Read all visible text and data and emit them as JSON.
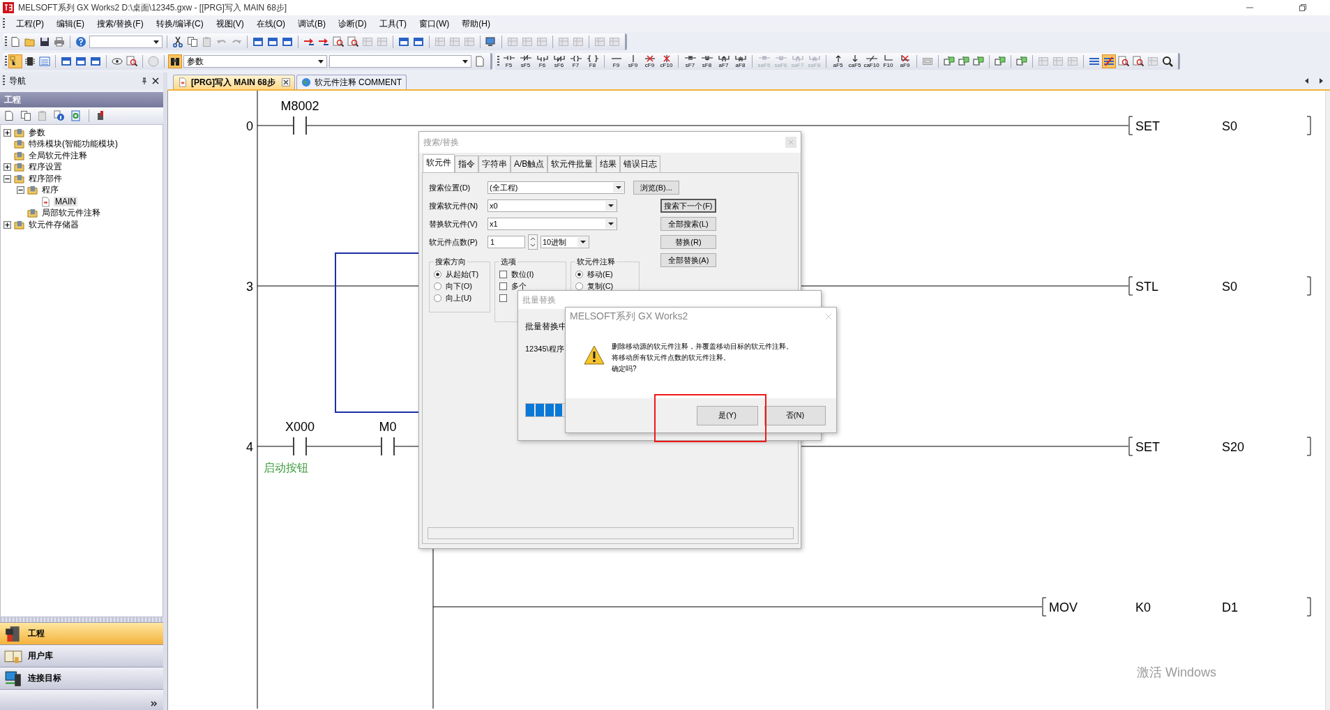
{
  "window": {
    "title": "MELSOFT系列 GX Works2 D:\\桌面\\12345.gxw - [[PRG]写入 MAIN 68步]"
  },
  "menu": [
    "工程(P)",
    "编辑(E)",
    "搜索/替换(F)",
    "转换/编译(C)",
    "视图(V)",
    "在线(O)",
    "调试(B)",
    "诊断(D)",
    "工具(T)",
    "窗口(W)",
    "帮助(H)"
  ],
  "toolbar": {
    "element_combo": "参数"
  },
  "toggle_buttons": [
    {
      "selected": true
    },
    {
      "selected": true
    },
    {
      "selected": true
    }
  ],
  "function_key_groups": [
    [
      {
        "label": "F5",
        "kind": "contact",
        "disabled": false
      },
      {
        "label": "sF5",
        "kind": "nc",
        "disabled": false
      },
      {
        "label": "F6",
        "kind": "par",
        "disabled": false
      },
      {
        "label": "sF6",
        "kind": "par_nc",
        "disabled": false
      },
      {
        "label": "F7",
        "kind": "coil",
        "disabled": false
      },
      {
        "label": "F8",
        "kind": "func",
        "disabled": false
      }
    ],
    [
      {
        "label": "F9",
        "kind": "hline",
        "disabled": false
      },
      {
        "label": "sF9",
        "kind": "vline",
        "disabled": false
      },
      {
        "label": "cF9",
        "kind": "del_h",
        "disabled": false
      },
      {
        "label": "cF10",
        "kind": "del_v",
        "disabled": false
      }
    ],
    [
      {
        "label": "sF7",
        "kind": "rise",
        "disabled": false
      },
      {
        "label": "sF8",
        "kind": "fall",
        "disabled": false
      },
      {
        "label": "aF7",
        "kind": "par_rise",
        "disabled": false
      },
      {
        "label": "aF8",
        "kind": "par_fall",
        "disabled": false
      }
    ],
    [
      {
        "label": "saF5",
        "kind": "rise",
        "disabled": true
      },
      {
        "label": "saF6",
        "kind": "fall",
        "disabled": true
      },
      {
        "label": "saF7",
        "kind": "par_rise",
        "disabled": true
      },
      {
        "label": "saF8",
        "kind": "par_fall",
        "disabled": true
      }
    ],
    [
      {
        "label": "aF5",
        "kind": "up",
        "disabled": false
      },
      {
        "label": "caF5",
        "kind": "down",
        "disabled": false
      },
      {
        "label": "caF10",
        "kind": "invert",
        "disabled": false
      },
      {
        "label": "F10",
        "kind": "draw",
        "disabled": false
      },
      {
        "label": "aF9",
        "kind": "del_draw",
        "disabled": false
      }
    ]
  ],
  "navigation": {
    "title": "导航",
    "section": "工程",
    "tree": [
      {
        "label": "参数",
        "expanded": false,
        "selected": false
      },
      {
        "label": "特殊模块(智能功能模块)",
        "selected": false
      },
      {
        "label": "全局软元件注释",
        "selected": false
      },
      {
        "label": "程序设置",
        "expanded": false,
        "selected": false
      },
      {
        "label": "程序部件",
        "expanded": true,
        "selected": false,
        "children": [
          {
            "label": "程序",
            "expanded": true,
            "selected": false,
            "children": [
              {
                "label": "MAIN",
                "selected": true
              }
            ]
          },
          {
            "label": "局部软元件注释",
            "selected": false
          }
        ]
      },
      {
        "label": "软元件存储器",
        "expanded": false,
        "selected": false
      }
    ],
    "panels": [
      {
        "label": "工程",
        "selected": true
      },
      {
        "label": "用户库",
        "selected": false
      },
      {
        "label": "连接目标",
        "selected": false
      }
    ]
  },
  "editor_tabs": [
    {
      "label": "[PRG]写入 MAIN 68步",
      "selected": true
    },
    {
      "label": "软元件注释 COMMENT",
      "selected": false
    }
  ],
  "ladder": {
    "rungs": [
      {
        "kind": "rung",
        "step": "0",
        "selected": false,
        "contacts": [
          {
            "device": "M8002"
          }
        ],
        "instruction": [
          "SET",
          "S0"
        ]
      },
      {
        "kind": "rung",
        "step": "3",
        "selected": true,
        "instruction": [
          "STL",
          "S0"
        ]
      },
      {
        "kind": "rung",
        "step": "4",
        "selected": false,
        "contacts": [
          {
            "device": "X000",
            "comment": "启动按钮"
          },
          {
            "device": "M0"
          }
        ],
        "instruction": [
          "SET",
          "S20"
        ]
      },
      {
        "kind": "branch",
        "selected": false,
        "instruction": [
          "MOV",
          "K0",
          "D1"
        ]
      }
    ]
  },
  "search_dialog": {
    "title": "搜索/替换",
    "tabs": [
      {
        "label": "软元件",
        "selected": true
      },
      {
        "label": "指令",
        "selected": false
      },
      {
        "label": "字符串",
        "selected": false
      },
      {
        "label": "A/B触点",
        "selected": false
      },
      {
        "label": "软元件批量",
        "selected": false
      },
      {
        "label": "结果",
        "selected": false
      },
      {
        "label": "错误日志",
        "selected": false
      }
    ],
    "fields": [
      {
        "label": "搜索位置(D)",
        "value": "(全工程)",
        "button": "浏览(B)..."
      },
      {
        "label": "搜索软元件(N)",
        "value": "x0",
        "button": "搜索下一个(F)"
      },
      {
        "label": "替换软元件(V)",
        "value": "x1",
        "button": "全部搜索(L)"
      }
    ],
    "count": {
      "label": "软元件点数(P)",
      "value": "1",
      "radix": "10进制"
    },
    "buttons": [
      "替换(R)",
      "全部替换(A)"
    ],
    "direction": {
      "title": "搜索方向",
      "options": [
        {
          "label": "从起始(T)",
          "selected": true
        },
        {
          "label": "向下(O)",
          "selected": false
        },
        {
          "label": "向上(U)",
          "selected": false
        }
      ]
    },
    "options": {
      "title": "选项",
      "items": [
        {
          "label": "数位(I)",
          "checked": false
        },
        {
          "label": "多个",
          "checked": false
        },
        {
          "checked": false
        }
      ]
    },
    "comment": {
      "title": "软元件注释",
      "options": [
        {
          "label": "移动(E)",
          "selected": true
        },
        {
          "label": "复制(C)",
          "selected": false
        }
      ]
    }
  },
  "batch_dialog": {
    "title": "批量替换",
    "status": "批量替换中",
    "path": "12345\\程序",
    "progress": {
      "level": 0.13
    }
  },
  "message_box": {
    "title": "MELSOFT系列 GX Works2",
    "lines": [
      "删除移动源的软元件注释，并覆盖移动目标的软元件注释。",
      "将移动所有软元件点数的软元件注释。",
      "确定吗?"
    ],
    "buttons": [
      "是(Y)",
      "否(N)"
    ]
  },
  "os_notice": "激活 Windows"
}
